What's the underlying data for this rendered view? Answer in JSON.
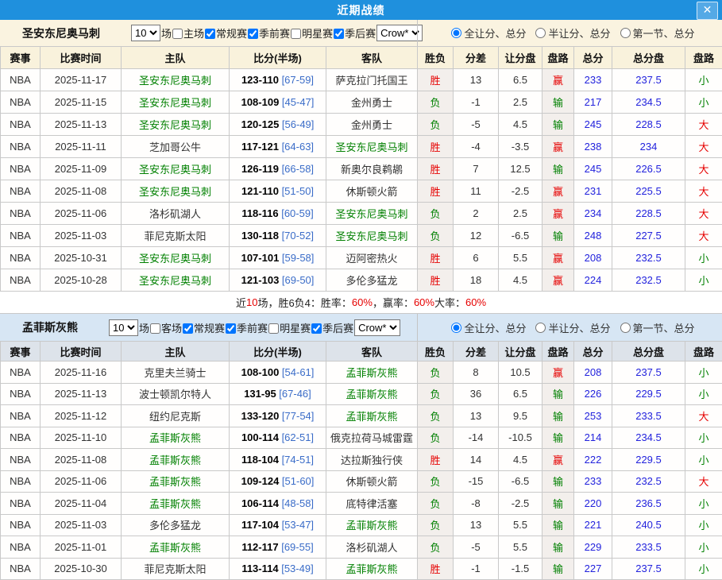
{
  "header": {
    "title": "近期战绩",
    "close_label": "✕"
  },
  "colors": {
    "titlebar_blue": "#1f90dd",
    "win_red": "#e60000",
    "loss_green": "#008000",
    "total_blue": "#2222dd",
    "focus_team_green": "#008000",
    "section1_bg": "#faf3e0",
    "section2_bg": "#d7e6f4"
  },
  "sections": [
    {
      "team_name": "圣安东尼奥马刺",
      "games_count": "10",
      "games_label": "场",
      "checkboxes": [
        {
          "label": "主场",
          "checked": false
        },
        {
          "label": "常规赛",
          "checked": true
        },
        {
          "label": "季前赛",
          "checked": true
        },
        {
          "label": "明星赛",
          "checked": false
        },
        {
          "label": "季后赛",
          "checked": true
        }
      ],
      "bookmaker": "Crow*",
      "radios": [
        {
          "label": "全让分、总分",
          "selected": true
        },
        {
          "label": "半让分、总分",
          "selected": false
        },
        {
          "label": "第一节、总分",
          "selected": false
        }
      ],
      "columns": [
        "赛事",
        "比赛时间",
        "主队",
        "比分(半场)",
        "客队",
        "胜负",
        "分差",
        "让分盘",
        "盘路",
        "总分",
        "总分盘",
        "盘路"
      ],
      "rows": [
        {
          "league": "NBA",
          "date": "2025-11-17",
          "home": "圣安东尼奥马刺",
          "home_focus": true,
          "score": "123-110",
          "half": "[67-59]",
          "away": "萨克拉门托国王",
          "away_focus": false,
          "result": "胜",
          "diff": "13",
          "handicap": "6.5",
          "handicap_result": "赢",
          "total": "233",
          "total_line": "237.5",
          "ou_result": "小"
        },
        {
          "league": "NBA",
          "date": "2025-11-15",
          "home": "圣安东尼奥马刺",
          "home_focus": true,
          "score": "108-109",
          "half": "[45-47]",
          "away": "金州勇士",
          "away_focus": false,
          "result": "负",
          "diff": "-1",
          "handicap": "2.5",
          "handicap_result": "输",
          "total": "217",
          "total_line": "234.5",
          "ou_result": "小"
        },
        {
          "league": "NBA",
          "date": "2025-11-13",
          "home": "圣安东尼奥马刺",
          "home_focus": true,
          "score": "120-125",
          "half": "[56-49]",
          "away": "金州勇士",
          "away_focus": false,
          "result": "负",
          "diff": "-5",
          "handicap": "4.5",
          "handicap_result": "输",
          "total": "245",
          "total_line": "228.5",
          "ou_result": "大"
        },
        {
          "league": "NBA",
          "date": "2025-11-11",
          "home": "芝加哥公牛",
          "home_focus": false,
          "score": "117-121",
          "half": "[64-63]",
          "away": "圣安东尼奥马刺",
          "away_focus": true,
          "result": "胜",
          "diff": "-4",
          "handicap": "-3.5",
          "handicap_result": "赢",
          "total": "238",
          "total_line": "234",
          "ou_result": "大"
        },
        {
          "league": "NBA",
          "date": "2025-11-09",
          "home": "圣安东尼奥马刺",
          "home_focus": true,
          "score": "126-119",
          "half": "[66-58]",
          "away": "新奥尔良鹈鹕",
          "away_focus": false,
          "result": "胜",
          "diff": "7",
          "handicap": "12.5",
          "handicap_result": "输",
          "total": "245",
          "total_line": "226.5",
          "ou_result": "大"
        },
        {
          "league": "NBA",
          "date": "2025-11-08",
          "home": "圣安东尼奥马刺",
          "home_focus": true,
          "score": "121-110",
          "half": "[51-50]",
          "away": "休斯顿火箭",
          "away_focus": false,
          "result": "胜",
          "diff": "11",
          "handicap": "-2.5",
          "handicap_result": "赢",
          "total": "231",
          "total_line": "225.5",
          "ou_result": "大"
        },
        {
          "league": "NBA",
          "date": "2025-11-06",
          "home": "洛杉矶湖人",
          "home_focus": false,
          "score": "118-116",
          "half": "[60-59]",
          "away": "圣安东尼奥马刺",
          "away_focus": true,
          "result": "负",
          "diff": "2",
          "handicap": "2.5",
          "handicap_result": "赢",
          "total": "234",
          "total_line": "228.5",
          "ou_result": "大"
        },
        {
          "league": "NBA",
          "date": "2025-11-03",
          "home": "菲尼克斯太阳",
          "home_focus": false,
          "score": "130-118",
          "half": "[70-52]",
          "away": "圣安东尼奥马刺",
          "away_focus": true,
          "result": "负",
          "diff": "12",
          "handicap": "-6.5",
          "handicap_result": "输",
          "total": "248",
          "total_line": "227.5",
          "ou_result": "大"
        },
        {
          "league": "NBA",
          "date": "2025-10-31",
          "home": "圣安东尼奥马刺",
          "home_focus": true,
          "score": "107-101",
          "half": "[59-58]",
          "away": "迈阿密热火",
          "away_focus": false,
          "result": "胜",
          "diff": "6",
          "handicap": "5.5",
          "handicap_result": "赢",
          "total": "208",
          "total_line": "232.5",
          "ou_result": "小"
        },
        {
          "league": "NBA",
          "date": "2025-10-28",
          "home": "圣安东尼奥马刺",
          "home_focus": true,
          "score": "121-103",
          "half": "[69-50]",
          "away": "多伦多猛龙",
          "away_focus": false,
          "result": "胜",
          "diff": "18",
          "handicap": "4.5",
          "handicap_result": "赢",
          "total": "224",
          "total_line": "232.5",
          "ou_result": "小"
        }
      ],
      "summary": {
        "parts": [
          {
            "text": "近 ",
            "red": false
          },
          {
            "text": "10",
            "red": true
          },
          {
            "text": " 场，胜6负4：胜率：",
            "red": false
          },
          {
            "text": "60%",
            "red": true
          },
          {
            "text": "，赢率：",
            "red": false
          },
          {
            "text": "60%",
            "red": true
          },
          {
            "text": " 大率：",
            "red": false
          },
          {
            "text": "60%",
            "red": true
          }
        ]
      }
    },
    {
      "team_name": "孟菲斯灰熊",
      "games_count": "10",
      "games_label": "场",
      "checkboxes": [
        {
          "label": "客场",
          "checked": false
        },
        {
          "label": "常规赛",
          "checked": true
        },
        {
          "label": "季前赛",
          "checked": true
        },
        {
          "label": "明星赛",
          "checked": false
        },
        {
          "label": "季后赛",
          "checked": true
        }
      ],
      "bookmaker": "Crow*",
      "radios": [
        {
          "label": "全让分、总分",
          "selected": true
        },
        {
          "label": "半让分、总分",
          "selected": false
        },
        {
          "label": "第一节、总分",
          "selected": false
        }
      ],
      "columns": [
        "赛事",
        "比赛时间",
        "主队",
        "比分(半场)",
        "客队",
        "胜负",
        "分差",
        "让分盘",
        "盘路",
        "总分",
        "总分盘",
        "盘路"
      ],
      "rows": [
        {
          "league": "NBA",
          "date": "2025-11-16",
          "home": "克里夫兰骑士",
          "home_focus": false,
          "score": "108-100",
          "half": "[54-61]",
          "away": "孟菲斯灰熊",
          "away_focus": true,
          "result": "负",
          "diff": "8",
          "handicap": "10.5",
          "handicap_result": "赢",
          "total": "208",
          "total_line": "237.5",
          "ou_result": "小"
        },
        {
          "league": "NBA",
          "date": "2025-11-13",
          "home": "波士顿凯尔特人",
          "home_focus": false,
          "score": "131-95",
          "half": "[67-46]",
          "away": "孟菲斯灰熊",
          "away_focus": true,
          "result": "负",
          "diff": "36",
          "handicap": "6.5",
          "handicap_result": "输",
          "total": "226",
          "total_line": "229.5",
          "ou_result": "小"
        },
        {
          "league": "NBA",
          "date": "2025-11-12",
          "home": "纽约尼克斯",
          "home_focus": false,
          "score": "133-120",
          "half": "[77-54]",
          "away": "孟菲斯灰熊",
          "away_focus": true,
          "result": "负",
          "diff": "13",
          "handicap": "9.5",
          "handicap_result": "输",
          "total": "253",
          "total_line": "233.5",
          "ou_result": "大"
        },
        {
          "league": "NBA",
          "date": "2025-11-10",
          "home": "孟菲斯灰熊",
          "home_focus": true,
          "score": "100-114",
          "half": "[62-51]",
          "away": "俄克拉荷马城雷霆",
          "away_focus": false,
          "result": "负",
          "diff": "-14",
          "handicap": "-10.5",
          "handicap_result": "输",
          "total": "214",
          "total_line": "234.5",
          "ou_result": "小"
        },
        {
          "league": "NBA",
          "date": "2025-11-08",
          "home": "孟菲斯灰熊",
          "home_focus": true,
          "score": "118-104",
          "half": "[74-51]",
          "away": "达拉斯独行侠",
          "away_focus": false,
          "result": "胜",
          "diff": "14",
          "handicap": "4.5",
          "handicap_result": "赢",
          "total": "222",
          "total_line": "229.5",
          "ou_result": "小"
        },
        {
          "league": "NBA",
          "date": "2025-11-06",
          "home": "孟菲斯灰熊",
          "home_focus": true,
          "score": "109-124",
          "half": "[51-60]",
          "away": "休斯顿火箭",
          "away_focus": false,
          "result": "负",
          "diff": "-15",
          "handicap": "-6.5",
          "handicap_result": "输",
          "total": "233",
          "total_line": "232.5",
          "ou_result": "大"
        },
        {
          "league": "NBA",
          "date": "2025-11-04",
          "home": "孟菲斯灰熊",
          "home_focus": true,
          "score": "106-114",
          "half": "[48-58]",
          "away": "底特律活塞",
          "away_focus": false,
          "result": "负",
          "diff": "-8",
          "handicap": "-2.5",
          "handicap_result": "输",
          "total": "220",
          "total_line": "236.5",
          "ou_result": "小"
        },
        {
          "league": "NBA",
          "date": "2025-11-03",
          "home": "多伦多猛龙",
          "home_focus": false,
          "score": "117-104",
          "half": "[53-47]",
          "away": "孟菲斯灰熊",
          "away_focus": true,
          "result": "负",
          "diff": "13",
          "handicap": "5.5",
          "handicap_result": "输",
          "total": "221",
          "total_line": "240.5",
          "ou_result": "小"
        },
        {
          "league": "NBA",
          "date": "2025-11-01",
          "home": "孟菲斯灰熊",
          "home_focus": true,
          "score": "112-117",
          "half": "[69-55]",
          "away": "洛杉矶湖人",
          "away_focus": false,
          "result": "负",
          "diff": "-5",
          "handicap": "5.5",
          "handicap_result": "输",
          "total": "229",
          "total_line": "233.5",
          "ou_result": "小"
        },
        {
          "league": "NBA",
          "date": "2025-10-30",
          "home": "菲尼克斯太阳",
          "home_focus": false,
          "score": "113-114",
          "half": "[53-49]",
          "away": "孟菲斯灰熊",
          "away_focus": true,
          "result": "胜",
          "diff": "-1",
          "handicap": "-1.5",
          "handicap_result": "输",
          "total": "227",
          "total_line": "237.5",
          "ou_result": "小"
        }
      ],
      "summary": null
    }
  ]
}
